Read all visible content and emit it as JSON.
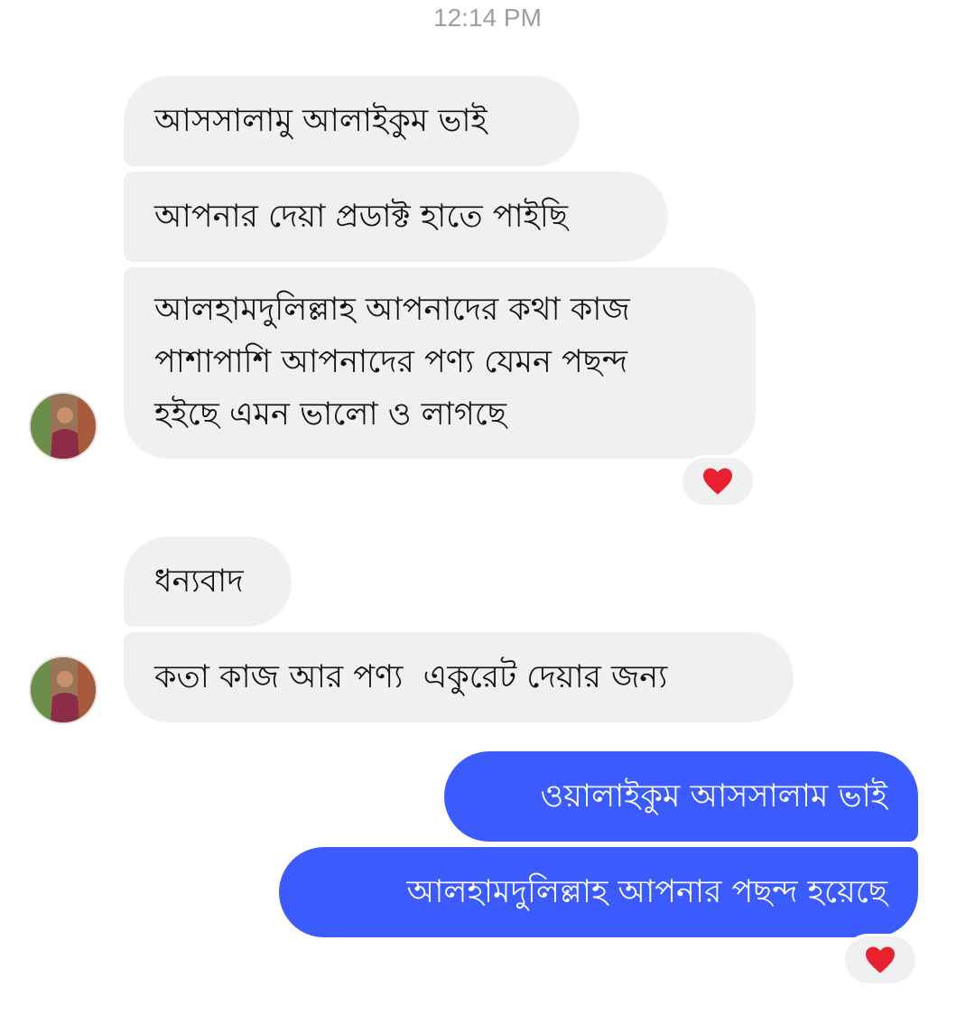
{
  "chat": {
    "timestamp": "12:14 PM",
    "incoming": [
      {
        "text": "আসসালামু আলাইকুম ভাই"
      },
      {
        "text": "আপনার দেয়া প্রডাক্ট হাতে পাইছি"
      },
      {
        "text": "আলহামদুলিল্লাহ আপনাদের কথা কাজ\nপাশাপাশি আপনাদের পণ্য যেমন পছন্দ\nহইছে এমন ভালো ও লাগছে"
      },
      {
        "text": "ধন্যবাদ"
      },
      {
        "text": "কতা কাজ আর পণ্য  একুরেট দেয়ার জন্য"
      }
    ],
    "outgoing": [
      {
        "text": "ওয়ালাইকুম আসসালাম ভাই"
      },
      {
        "text": "আলহামদুলিল্লাহ আপনার পছন্দ হয়েছে"
      }
    ],
    "reactions": [
      "heart-icon",
      "heart-icon"
    ],
    "colors": {
      "incoming_bubble": "#f0f0f0",
      "outgoing_bubble": "#3b5bfd",
      "heart": "#e8202f",
      "timestamp": "#9e9e9e"
    }
  }
}
